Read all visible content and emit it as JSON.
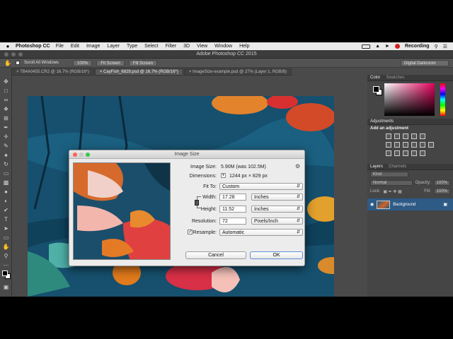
{
  "menubar": {
    "apple": "",
    "app": "Photoshop CC",
    "items": [
      "File",
      "Edit",
      "Image",
      "Layer",
      "Type",
      "Select",
      "Filter",
      "3D",
      "View",
      "Window",
      "Help"
    ],
    "status_text": "Recording"
  },
  "window": {
    "title": "Adobe Photoshop CC 2015"
  },
  "options": {
    "scroll_all_label": "Scroll All Windows",
    "btn_100": "100%",
    "btn_fit": "Fit Screen",
    "btn_fill": "Fill Screen",
    "workspace": "Digital Darkroom"
  },
  "tabs": [
    {
      "label": "TB4A0455.CR2 @ 16.7% (RGB/16*)"
    },
    {
      "label": "CayFish_6829.psd @ 16.7% (RGB/16*)"
    },
    {
      "label": "ImageSize-example.psd @ 27% (Layer 1, RGB/8)"
    }
  ],
  "panels": {
    "color_tab": "Color",
    "swatches_tab": "Swatches",
    "adjustments_tab": "Adjustments",
    "add_adjustment": "Add an adjustment",
    "layers_tab": "Layers",
    "channels_tab": "Channels",
    "kind": "Kind",
    "blend": "Normal",
    "opacity_label": "Opacity:",
    "opacity_val": "100%",
    "lock_label": "Lock:",
    "fill_label": "Fill:",
    "fill_val": "100%",
    "layer_name": "Background"
  },
  "dialog": {
    "title": "Image Size",
    "image_size_label": "Image Size:",
    "image_size_val": "5.90M (was 102.5M)",
    "dimensions_label": "Dimensions:",
    "dimensions_val": "1244 px  ×  829 px",
    "fit_to_label": "Fit To:",
    "fit_to_val": "Custom",
    "width_label": "Width:",
    "width_val": "17.28",
    "width_unit": "Inches",
    "height_label": "Height:",
    "height_val": "11.52",
    "height_unit": "Inches",
    "resolution_label": "Resolution:",
    "resolution_val": "72",
    "resolution_unit": "Pixels/Inch",
    "resample_label": "Resample:",
    "resample_val": "Automatic",
    "cancel": "Cancel",
    "ok": "OK"
  },
  "colors": {
    "accent": "#2e5a86",
    "water": "#16506e",
    "koi_orange": "#e0662a",
    "koi_red": "#d42a3a"
  }
}
